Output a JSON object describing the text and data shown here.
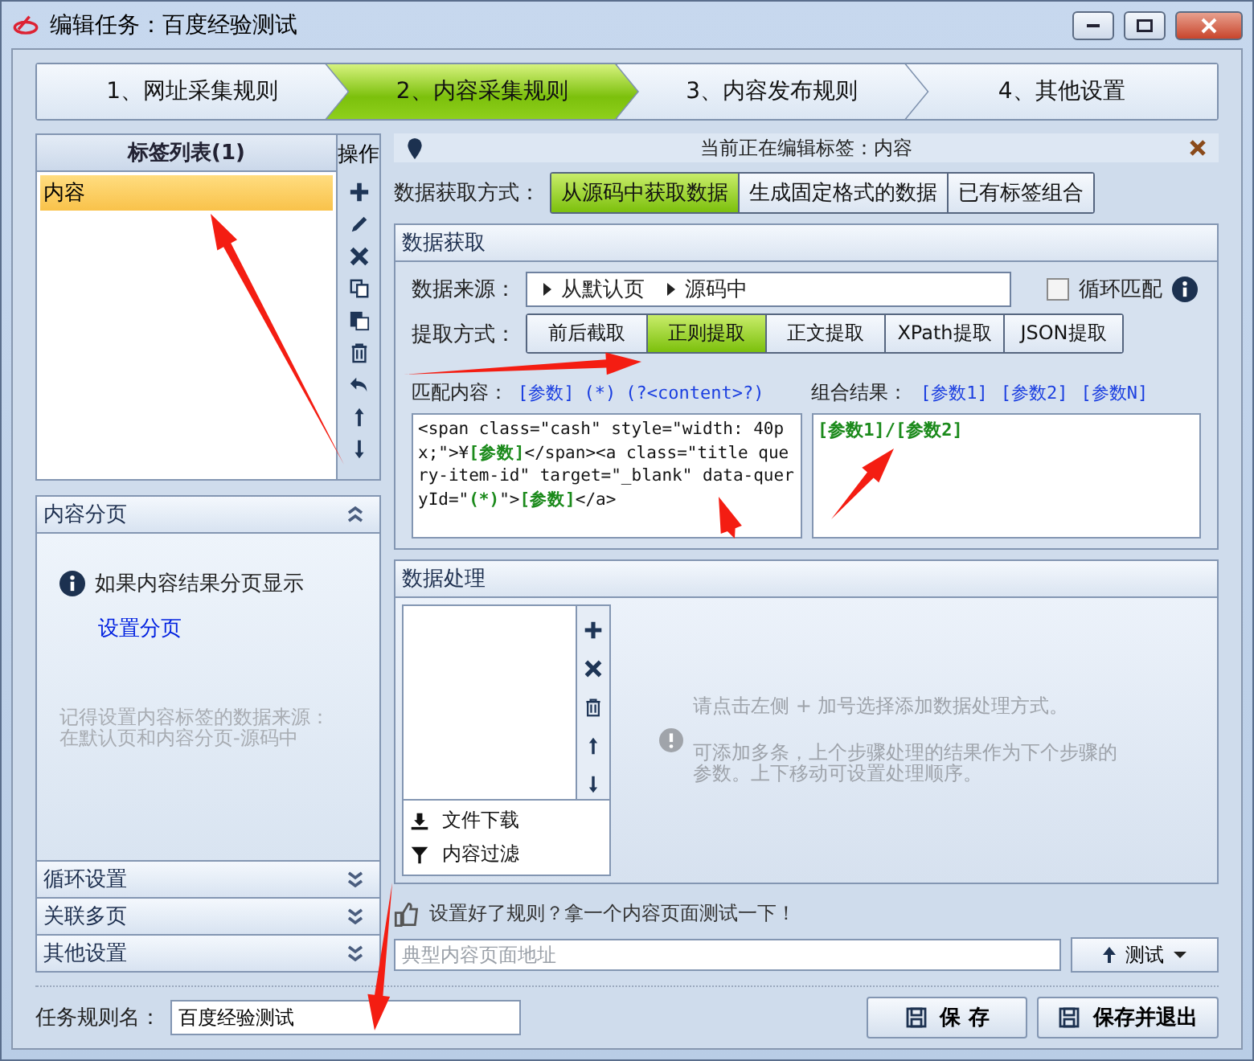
{
  "window": {
    "title": "编辑任务：百度经验测试"
  },
  "steps": [
    {
      "label": "1、网址采集规则",
      "selected": false
    },
    {
      "label": "2、内容采集规则",
      "selected": true
    },
    {
      "label": "3、内容发布规则",
      "selected": false
    },
    {
      "label": "4、其他设置",
      "selected": false
    }
  ],
  "tag_list": {
    "title": "标签列表(1)",
    "items": [
      {
        "label": "内容",
        "selected": true
      }
    ],
    "operations_label": "操作"
  },
  "sections": [
    {
      "title": "内容分页",
      "expanded": true,
      "info": "如果内容结果分页显示",
      "link": "设置分页",
      "hint": "记得设置内容标签的数据来源：在默认页和内容分页-源码中"
    },
    {
      "title": "循环设置",
      "expanded": false
    },
    {
      "title": "关联多页",
      "expanded": false
    },
    {
      "title": "其他设置",
      "expanded": false
    }
  ],
  "editing_bar": {
    "text": "当前正在编辑标签：内容"
  },
  "fetch_mode": {
    "label": "数据获取方式：",
    "options": [
      {
        "label": "从源码中获取数据",
        "selected": true
      },
      {
        "label": "生成固定格式的数据",
        "selected": false
      },
      {
        "label": "已有标签组合",
        "selected": false
      }
    ]
  },
  "data_fetch": {
    "title": "数据获取",
    "source": {
      "label": "数据来源：",
      "crumbs": [
        "从默认页",
        "源码中"
      ]
    },
    "loop_match": {
      "label": "循环匹配",
      "checked": false
    },
    "extract": {
      "label": "提取方式：",
      "options": [
        {
          "label": "前后截取",
          "selected": false
        },
        {
          "label": "正则提取",
          "selected": true
        },
        {
          "label": "正文提取",
          "selected": false
        },
        {
          "label": "XPath提取",
          "selected": false
        },
        {
          "label": "JSON提取",
          "selected": false
        }
      ]
    },
    "match": {
      "label": "匹配内容：",
      "tokens": [
        "[参数]",
        "(*)",
        "(?<content>?)"
      ],
      "value": "<span class=\"cash\" style=\"width: 40px;\">¥**[参数]**</span><a class=\"title query-item-id\" target=\"_blank\" data-queryId=\"**(*)**\">**[参数]**</a>"
    },
    "combine": {
      "label": "组合结果：",
      "tokens": [
        "[参数1]",
        "[参数2]",
        "[参数N]"
      ],
      "value": "[参数1]/[参数2]"
    }
  },
  "data_processing": {
    "title": "数据处理",
    "menu": [
      {
        "label": "文件下载",
        "kind": "download"
      },
      {
        "label": "内容过滤",
        "kind": "filter"
      }
    ],
    "hint": [
      "请点击左侧 + 加号选择添加数据处理方式。",
      "可添加多条，上个步骤处理的结果作为下个步骤的参数。上下移动可设置处理顺序。"
    ]
  },
  "test": {
    "prompt": "设置好了规则？拿一个内容页面测试一下！",
    "url_placeholder": "典型内容页面地址",
    "button": "测试"
  },
  "footer": {
    "name_label": "任务规则名：",
    "name_value": "百度经验测试",
    "buttons": [
      {
        "label": "保 存"
      },
      {
        "label": "保存并退出"
      }
    ]
  }
}
